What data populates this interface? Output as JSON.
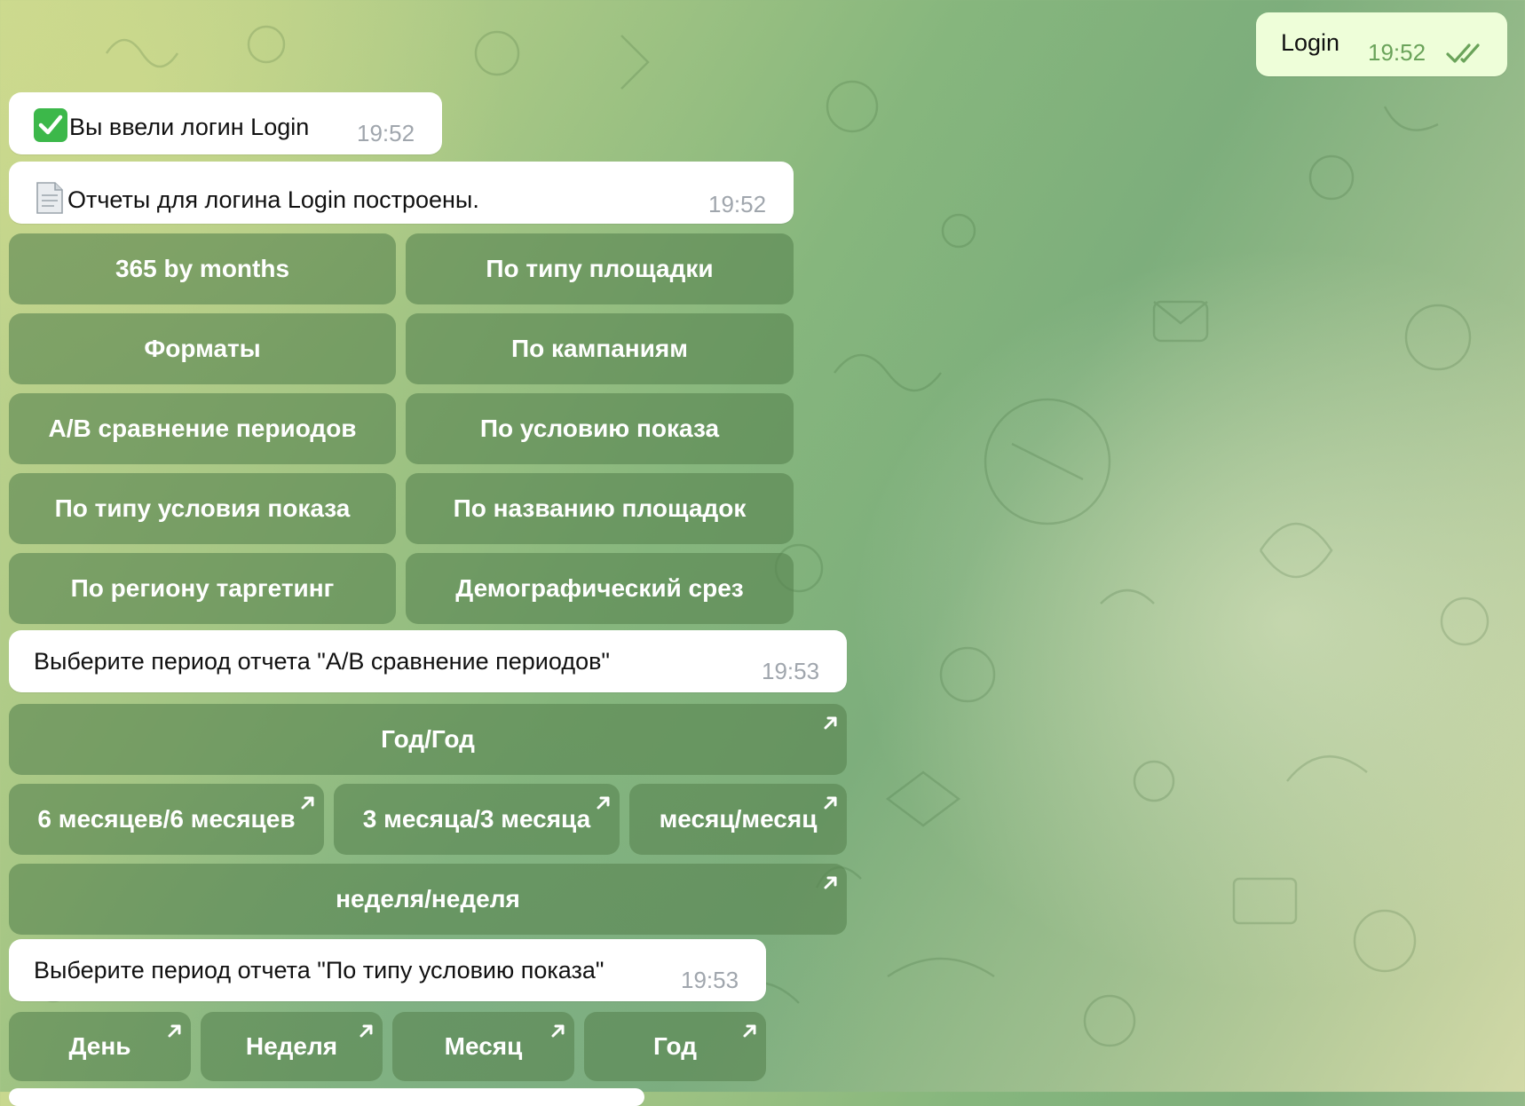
{
  "messages": {
    "out_login": {
      "text": "Login",
      "time": "19:52"
    },
    "login_entered": {
      "emoji": "check-icon",
      "text": "Вы ввели логин Login",
      "time": "19:52"
    },
    "reports_built": {
      "emoji": "document-icon",
      "text": "Отчеты для логина Login построены.",
      "time": "19:52"
    },
    "choose_ab": {
      "text": "Выберите период отчета \"A/B сравнение периодов\"",
      "time": "19:53"
    },
    "choose_cond": {
      "text": "Выберите период отчета \"По типу условию показа\"",
      "time": "19:53"
    }
  },
  "keyboard_reports": [
    "365 by months",
    "По типу площадки",
    "Форматы",
    "По кампаниям",
    "A/B сравнение периодов",
    "По условию показа",
    "По типу условия показа",
    "По названию площадок",
    "По региону таргетинг",
    "Демографический срез"
  ],
  "keyboard_ab_periods": {
    "year": "Год/Год",
    "six_months": "6 месяцев/6 месяцев",
    "three_months": "3 месяца/3 месяца",
    "month": "месяц/месяц",
    "week": "неделя/неделя"
  },
  "keyboard_cond_periods": [
    "День",
    "Неделя",
    "Месяц",
    "Год"
  ],
  "colors": {
    "incoming_bubble": "#ffffff",
    "outgoing_bubble": "#eefed9",
    "button_bg": "rgba(88,132,80,0.62)",
    "time_gray": "#a0a6ad",
    "time_green": "#6aa35a"
  }
}
